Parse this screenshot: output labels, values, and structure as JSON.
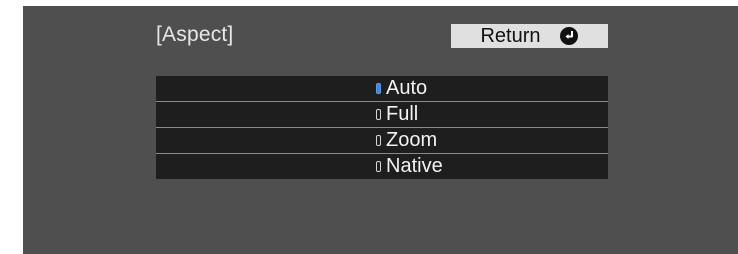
{
  "menu": {
    "title": "[Aspect]",
    "return_label": "Return",
    "return_icon": "enter-return-icon",
    "options": [
      {
        "label": "Auto",
        "selected": true
      },
      {
        "label": "Full",
        "selected": false
      },
      {
        "label": "Zoom",
        "selected": false
      },
      {
        "label": "Native",
        "selected": false
      }
    ]
  },
  "colors": {
    "panel_bg": "#4f4f4f",
    "row_bg": "#1e1e1e",
    "selected_indicator": "#3f86d6",
    "return_button_bg": "#e0e0e0"
  }
}
